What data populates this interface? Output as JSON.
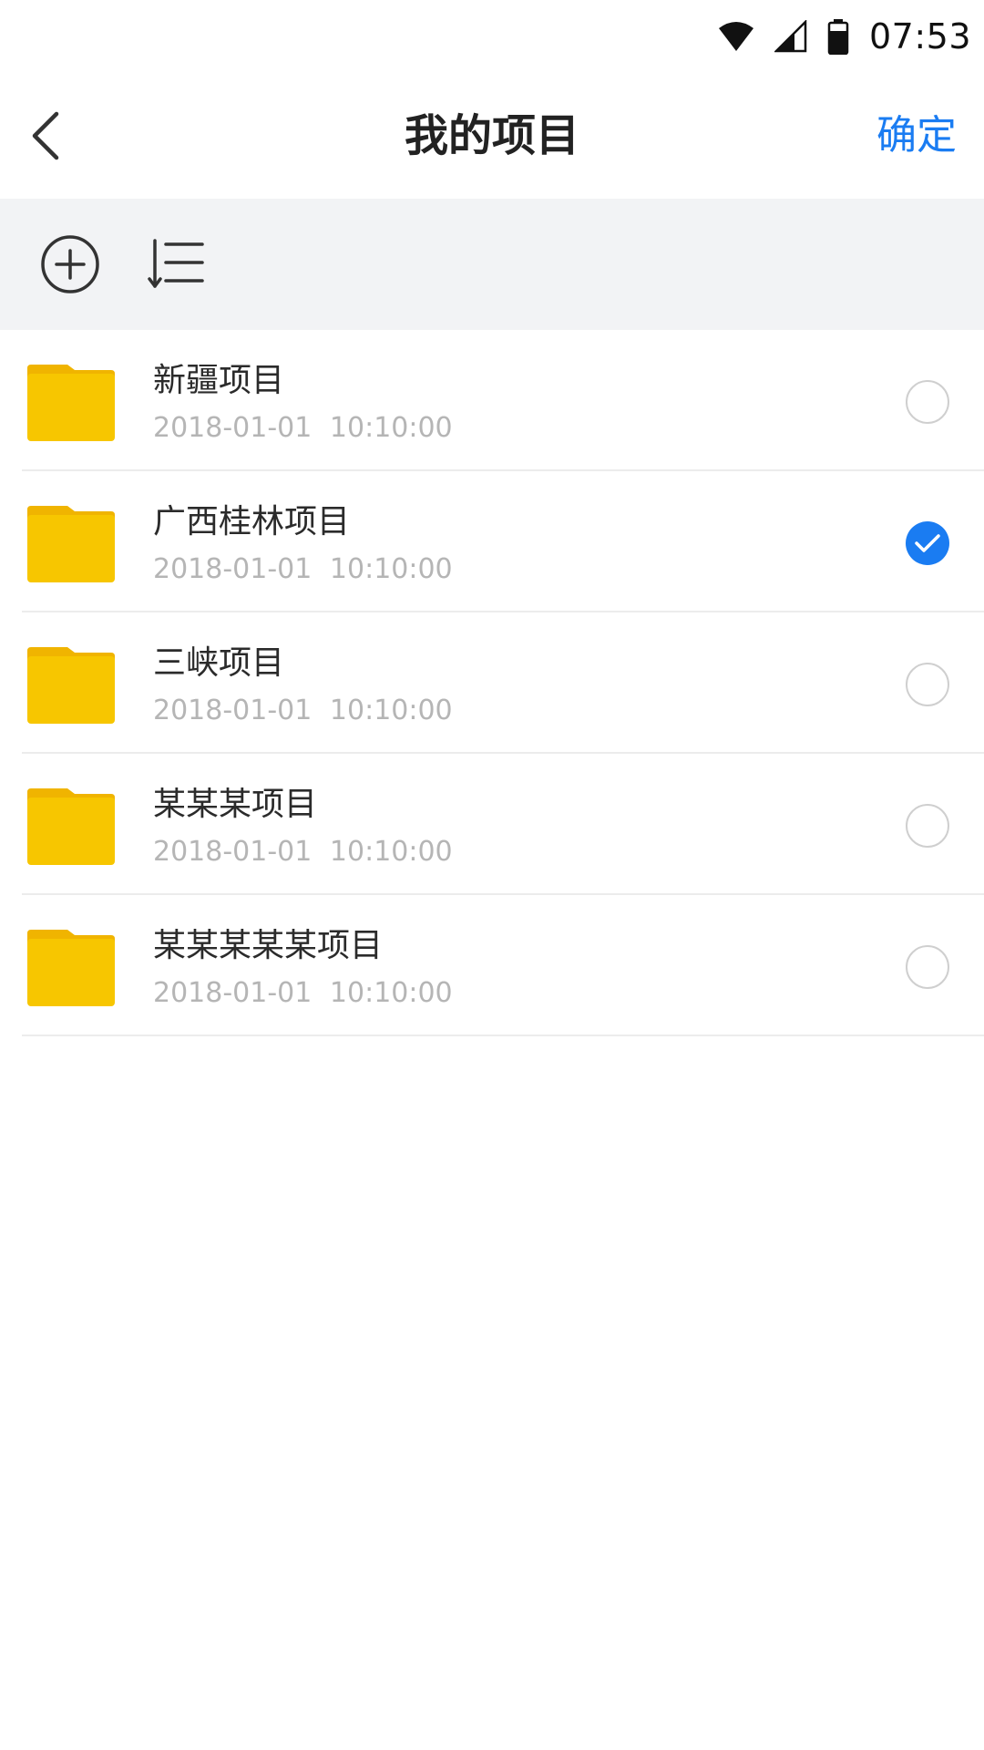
{
  "status_bar": {
    "time": "07:53",
    "icons": [
      "wifi-icon",
      "cell-signal-icon",
      "battery-icon"
    ]
  },
  "header": {
    "back_icon": "chevron-left-icon",
    "title": "我的项目",
    "confirm_label": "确定",
    "accent_color": "#1a7cf2"
  },
  "toolbar": {
    "tools": [
      "add-circle-icon",
      "sort-list-icon"
    ]
  },
  "projects": [
    {
      "name": "新疆项目",
      "date": "2018-01-01",
      "time": "10:10:00",
      "selected": false
    },
    {
      "name": "广西桂林项目",
      "date": "2018-01-01",
      "time": "10:10:00",
      "selected": true
    },
    {
      "name": "三峡项目",
      "date": "2018-01-01",
      "time": "10:10:00",
      "selected": false
    },
    {
      "name": "某某某项目",
      "date": "2018-01-01",
      "time": "10:10:00",
      "selected": false
    },
    {
      "name": "某某某某某项目",
      "date": "2018-01-01",
      "time": "10:10:00",
      "selected": false
    }
  ],
  "colors": {
    "folder": "#f7c600",
    "folder_tab": "#f0b400",
    "toolbar_bg": "#f2f3f5",
    "timestamp": "#b5b5b5"
  }
}
